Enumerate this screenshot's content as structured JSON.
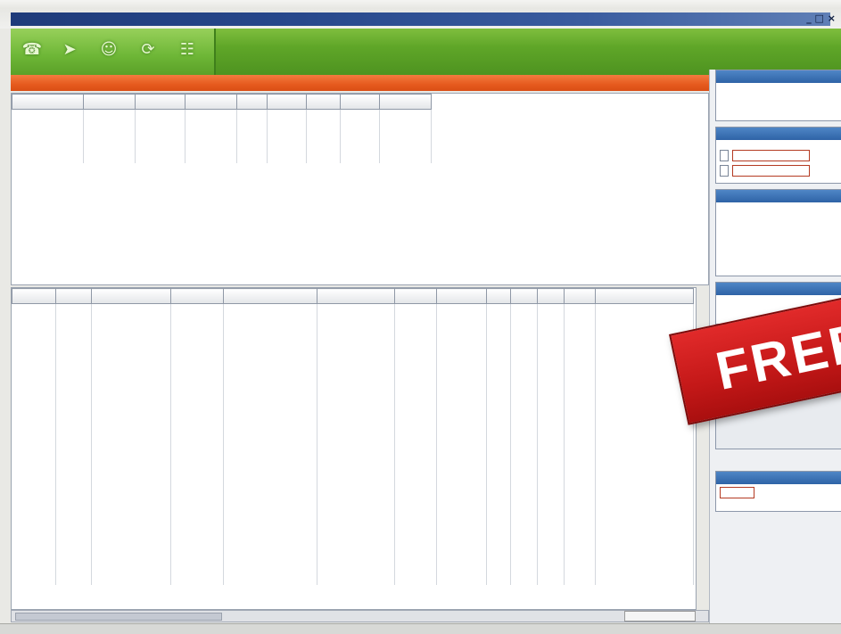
{
  "window": {
    "title": "",
    "controls": "_ □ ×"
  },
  "toolbar": {
    "icons": [
      "phone-icon",
      "arrow-icon",
      "person-icon",
      "refresh-icon",
      "contacts-icon"
    ],
    "info": ""
  },
  "top_table": {
    "headers": [
      "",
      "",
      "",
      "",
      "",
      "",
      "",
      "",
      ""
    ],
    "rows": [
      [
        "",
        "",
        "",
        "",
        "",
        "",
        "",
        "",
        ""
      ],
      [
        "",
        "",
        "",
        "",
        "",
        "",
        "",
        "",
        ""
      ],
      [
        "",
        "",
        "",
        "",
        "",
        "",
        "",
        "",
        ""
      ],
      [
        "",
        "",
        "",
        "",
        "",
        "",
        "",
        "",
        ""
      ]
    ]
  },
  "bottom_table": {
    "headers": [
      "",
      "",
      "",
      "",
      "",
      "",
      "",
      "",
      "",
      "",
      "",
      "",
      ""
    ],
    "rows": [
      [
        "",
        "",
        "",
        "",
        "",
        "",
        "",
        "",
        "",
        "",
        "",
        "",
        ""
      ],
      [
        "",
        "",
        "",
        "",
        "",
        "",
        "",
        "",
        "",
        "",
        "",
        "",
        ""
      ],
      [
        "",
        "",
        "",
        "",
        "",
        "",
        "",
        "",
        "",
        "",
        "",
        "",
        ""
      ],
      [
        "",
        "",
        "",
        "",
        "",
        "",
        "",
        "",
        "",
        "",
        "",
        "",
        ""
      ],
      [
        "",
        "",
        "",
        "",
        "",
        "",
        "",
        "",
        "",
        "",
        "",
        "",
        ""
      ],
      [
        "",
        "",
        "",
        "",
        "",
        "",
        "",
        "",
        "",
        "",
        "",
        "",
        ""
      ],
      [
        "",
        "",
        "",
        "",
        "",
        "",
        "",
        "",
        "",
        "",
        "",
        "",
        ""
      ],
      [
        "",
        "",
        "",
        "",
        "",
        "",
        "",
        "",
        "",
        "",
        "",
        "",
        ""
      ],
      [
        "",
        "",
        "",
        "",
        "",
        "",
        "",
        "",
        "",
        "",
        "",
        "",
        ""
      ],
      [
        "",
        "",
        "",
        "",
        "",
        "",
        "",
        "",
        "",
        "",
        "",
        "",
        ""
      ],
      [
        "",
        "",
        "",
        "",
        "",
        "",
        "",
        "",
        "",
        "",
        "",
        "",
        ""
      ],
      [
        "",
        "",
        "",
        "",
        "",
        "",
        "",
        "",
        "",
        "",
        "",
        "",
        ""
      ],
      [
        "",
        "",
        "",
        "",
        "",
        "",
        "",
        "",
        "",
        "",
        "",
        "",
        ""
      ],
      [
        "",
        "",
        "",
        "",
        "",
        "",
        "",
        "",
        "",
        "",
        "",
        "",
        ""
      ],
      [
        "",
        "",
        "",
        "",
        "",
        "",
        "",
        "",
        "",
        "",
        "",
        "",
        ""
      ],
      [
        "",
        "",
        "",
        "",
        "",
        "",
        "",
        "",
        "",
        "",
        "",
        "",
        ""
      ],
      [
        "",
        "",
        "",
        "",
        "",
        "",
        "",
        "",
        "",
        "",
        "",
        "",
        ""
      ],
      [
        "",
        "",
        "",
        "",
        "",
        "",
        "",
        "",
        "",
        "",
        "",
        "",
        ""
      ],
      [
        "",
        "",
        "",
        "",
        "",
        "",
        "",
        "",
        "",
        "",
        "",
        "",
        ""
      ],
      [
        "",
        "",
        "",
        "",
        "",
        "",
        "",
        "",
        "",
        "",
        "",
        "",
        ""
      ],
      [
        "",
        "",
        "",
        "",
        "",
        "",
        "",
        "",
        "",
        "",
        "",
        "",
        ""
      ]
    ]
  },
  "sidebar": {
    "panel1": {
      "header": "",
      "body": ""
    },
    "panel2": {
      "header": "",
      "from": "",
      "to": ""
    },
    "panel3": {
      "header": "",
      "items": [
        [
          "",
          ""
        ],
        [
          "",
          ""
        ],
        [
          "",
          ""
        ],
        [
          "",
          ""
        ],
        [
          "",
          ""
        ],
        [
          "",
          ""
        ]
      ]
    },
    "panel4": {
      "header": "",
      "items": [
        [
          "",
          ""
        ],
        [
          "",
          ""
        ]
      ]
    },
    "panel5": {
      "header": "",
      "label": "",
      "value": ""
    }
  },
  "badge": {
    "text": "FREE"
  },
  "pager": {
    "text": ""
  },
  "status": {
    "text": ""
  },
  "colors": {
    "toolbar_green": "#5fa628",
    "band_orange": "#e65a1e",
    "panel_blue": "#2e63a6",
    "badge_red": "#c41818"
  }
}
